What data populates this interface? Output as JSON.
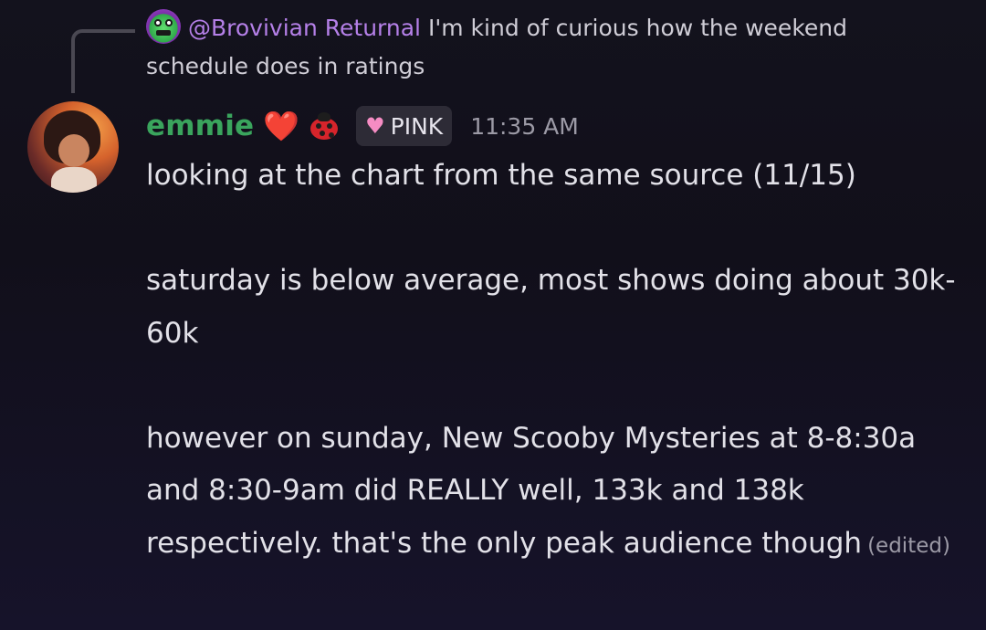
{
  "reply": {
    "username": "@Brovivian Returnal",
    "text": "I'm kind of curious how the weekend schedule does in ratings",
    "avatar_icon": "green-alien-avatar-icon"
  },
  "message": {
    "username": "emmie",
    "username_color": "#3aa55d",
    "emoji_1": "❤️",
    "emoji_2": "ladybug",
    "role": {
      "icon": "pink-heart-icon",
      "label": "PINK"
    },
    "timestamp": "11:35 AM",
    "paragraphs": [
      "looking at the chart from the same source (11/15)",
      "saturday is below average, most shows doing about 30k-60k",
      "however on sunday, New Scooby Mysteries at 8-8:30a and 8:30-9am did REALLY well, 133k and 138k respectively. that's the only peak audience though"
    ],
    "edited_label": "(edited)"
  }
}
